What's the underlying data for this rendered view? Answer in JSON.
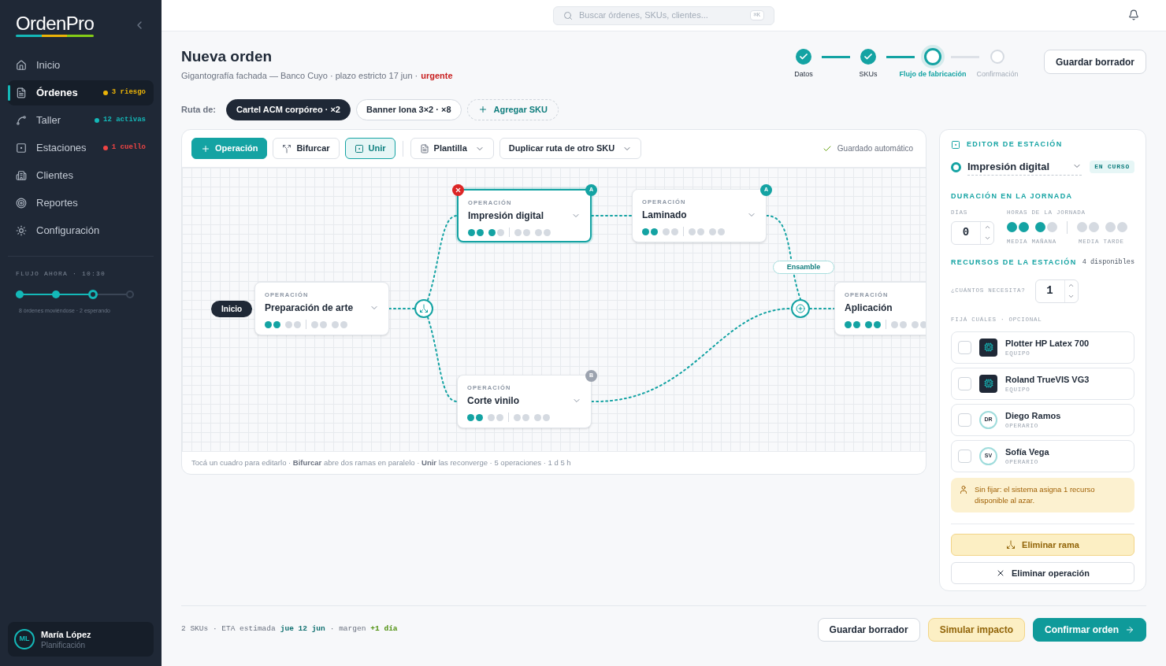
{
  "brand": {
    "name": "OrdenPro"
  },
  "sidebar": {
    "items": [
      {
        "label": "Inicio",
        "selected": false
      },
      {
        "label": "Órdenes",
        "selected": true,
        "badge": "3 riesgo",
        "color": "#eab308"
      },
      {
        "label": "Taller",
        "selected": false,
        "badge": "12 activas",
        "color": "#14b8b8"
      },
      {
        "label": "Estaciones",
        "selected": false,
        "badge": "1 cuello",
        "color": "#ef4444"
      },
      {
        "label": "Clientes",
        "selected": false
      },
      {
        "label": "Reportes",
        "selected": false
      },
      {
        "label": "Configuración",
        "selected": false
      }
    ],
    "flow": {
      "title": "FLUJO AHORA · 10:30",
      "steps": [
        {
          "done": true,
          "selected": false
        },
        {
          "done": true,
          "selected": false
        },
        {
          "done": false,
          "selected": true
        },
        {
          "done": false,
          "selected": false
        }
      ],
      "caption": "8 órdenes moviéndose · 2 esperando"
    },
    "user": {
      "initials": "ML",
      "name": "María López",
      "role": "Planificación"
    }
  },
  "search": {
    "placeholder": "Buscar órdenes, SKUs, clientes...",
    "shortcut": "⌘K"
  },
  "header": {
    "title": "Nueva orden",
    "subtitle": "Gigantografía fachada — Banco Cuyo · plazo estricto 17 jun ·",
    "flag": "urgente"
  },
  "stepper": [
    {
      "label": "Datos",
      "done": true,
      "selected": false
    },
    {
      "label": "SKUs",
      "done": true,
      "selected": false
    },
    {
      "label": "Flujo de fabricación",
      "done": false,
      "selected": true
    },
    {
      "label": "Confirmación",
      "done": false,
      "selected": false
    }
  ],
  "save_button": "Guardar borrador",
  "route": {
    "label": "Ruta de:",
    "skus": [
      {
        "label": "Cartel ACM corpóreo · ×2",
        "selected": true
      },
      {
        "label": "Banner lona 3×2 · ×8",
        "selected": false
      }
    ],
    "add": "Agregar SKU"
  },
  "toolbar": {
    "buttons": [
      {
        "label": "Operación",
        "kind": "primary"
      },
      {
        "label": "Bifurcar",
        "kind": "plain"
      },
      {
        "label": "Unir",
        "kind": "active"
      },
      {
        "label": "Plantilla",
        "kind": "dropdown"
      },
      {
        "label": "Duplicar ruta de otro SKU",
        "kind": "dropdown"
      }
    ],
    "status": "Guardado automático"
  },
  "canvas": {
    "start": "Inicio",
    "merge_label": "Ensamble",
    "nodes": [
      {
        "caption": "OPERACIÓN",
        "name": "Preparación de arte",
        "level": 0.25,
        "selected": false
      },
      {
        "caption": "OPERACIÓN",
        "name": "Impresión digital",
        "level": 0.375,
        "selected": true,
        "badge": "A",
        "color": "#14a3a3",
        "removable": true
      },
      {
        "caption": "OPERACIÓN",
        "name": "Laminado",
        "level": 0.25,
        "selected": false,
        "badge": "A",
        "color": "#14a3a3"
      },
      {
        "caption": "OPERACIÓN",
        "name": "Corte vinilo",
        "level": 0.25,
        "selected": false,
        "badge": "B",
        "color": "#9ca3af"
      },
      {
        "caption": "OPERACIÓN",
        "name": "Aplicación",
        "level": 0.5,
        "selected": false
      }
    ],
    "caption": "Tocá un cuadro para editarlo · **Bifurcar** abre dos ramas en paralelo · **Unir** las reconverge · 5 operaciones · 1 d 5 h"
  },
  "editor": {
    "title": "EDITOR DE ESTACIÓN",
    "station": "Impresión digital",
    "status": "EN CURSO",
    "duration_title": "DURACIÓN EN LA JORNADA",
    "days_label": "DÍAS",
    "days": "0",
    "hours_label": "HORAS DE LA JORNADA",
    "level": 0.375,
    "morning": "MEDIA MAÑANA",
    "afternoon": "MEDIA TARDE",
    "resources_title": "RECURSOS DE LA ESTACIÓN",
    "available": "4 disponibles",
    "count_label": "¿CUÁNTOS NECESITA?",
    "count": "1",
    "pin_label": "FIJÁ CUÁLES · OPCIONAL",
    "resources": [
      {
        "name": "Plotter HP Latex 700",
        "type": "EQUIPO",
        "kind": "equipment",
        "checked": false
      },
      {
        "name": "Roland TrueVIS VG3",
        "type": "EQUIPO",
        "kind": "equipment",
        "checked": false
      },
      {
        "name": "Diego Ramos",
        "type": "OPERARIO",
        "kind": "person",
        "initials": "DR",
        "checked": false
      },
      {
        "name": "Sofía Vega",
        "type": "OPERARIO",
        "kind": "person",
        "initials": "SV",
        "checked": false
      }
    ],
    "note": "Sin fijar: el sistema asigna 1 recurso disponible al azar.",
    "remove_branch": "Eliminar rama",
    "remove_operation": "Eliminar operación"
  },
  "footer": {
    "text": "2 SKUs · ETA estimada",
    "eta": "jue 12 jun",
    "sep": "· margen",
    "margin": "+1 día",
    "buttons": [
      {
        "label": "Guardar borrador",
        "kind": "secondary"
      },
      {
        "label": "Simular impacto",
        "kind": "warning"
      },
      {
        "label": "Confirmar orden",
        "kind": "primary"
      }
    ]
  }
}
